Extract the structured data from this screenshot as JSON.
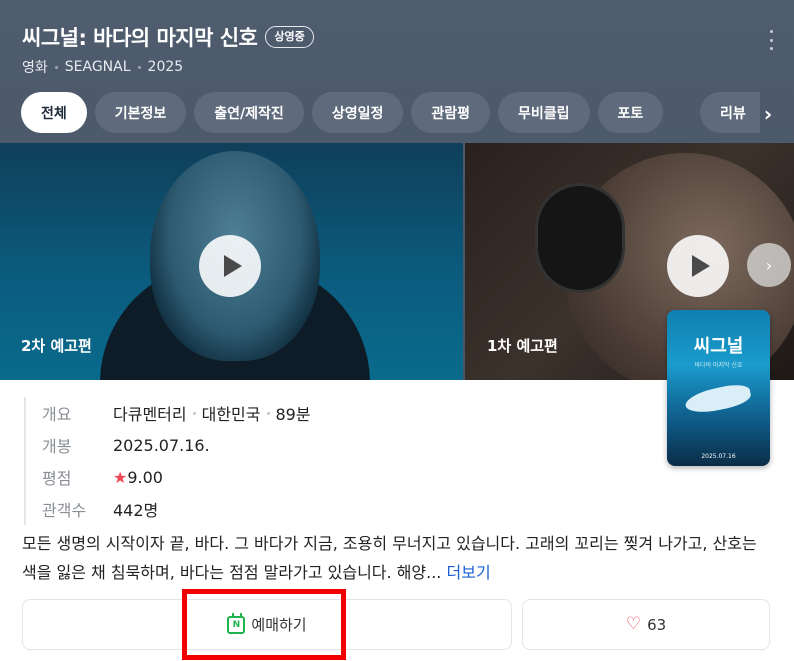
{
  "header": {
    "title": "씨그널: 바다의 마지막 신호",
    "badge": "상영중",
    "meta": [
      "영화",
      "SEAGNAL",
      "2025"
    ]
  },
  "tabs": [
    "전체",
    "기본정보",
    "출연/제작진",
    "상영일정",
    "관람평",
    "무비클립",
    "포토",
    "리뷰"
  ],
  "videos": [
    {
      "label": "2차 예고편"
    },
    {
      "label": "1차 예고편"
    }
  ],
  "poster": {
    "title": "씨그널",
    "subtitle": "바다의 마지막 신호",
    "date": "2025.07.16"
  },
  "info": {
    "overview_key": "개요",
    "genre": "다큐멘터리",
    "country": "대한민국",
    "runtime": "89분",
    "release_key": "개봉",
    "release": "2025.07.16.",
    "rating_key": "평점",
    "rating_star": "★",
    "rating": "9.00",
    "audience_key": "관객수",
    "audience": "442명"
  },
  "description": {
    "text": "모든 생명의 시작이자 끝, 바다. 그 바다가 지금, 조용히 무너지고 있습니다. 고래의 꼬리는 찢겨 나가고, 산호는 색을 잃은 채 침묵하며, 바다는 점점 말라가고 있습니다. 해양...",
    "more": "더보기"
  },
  "actions": {
    "book_label": "예매하기",
    "like_count": "63"
  },
  "colors": {
    "header_bg": "#4f5c6e",
    "star": "#f04452",
    "link": "#1a5fd6",
    "highlight": "#f20000",
    "naver_green": "#1fb34e"
  },
  "icons": [
    "more-vertical-icon",
    "chevron-right-icon",
    "play-icon",
    "calendar-icon",
    "heart-icon"
  ]
}
